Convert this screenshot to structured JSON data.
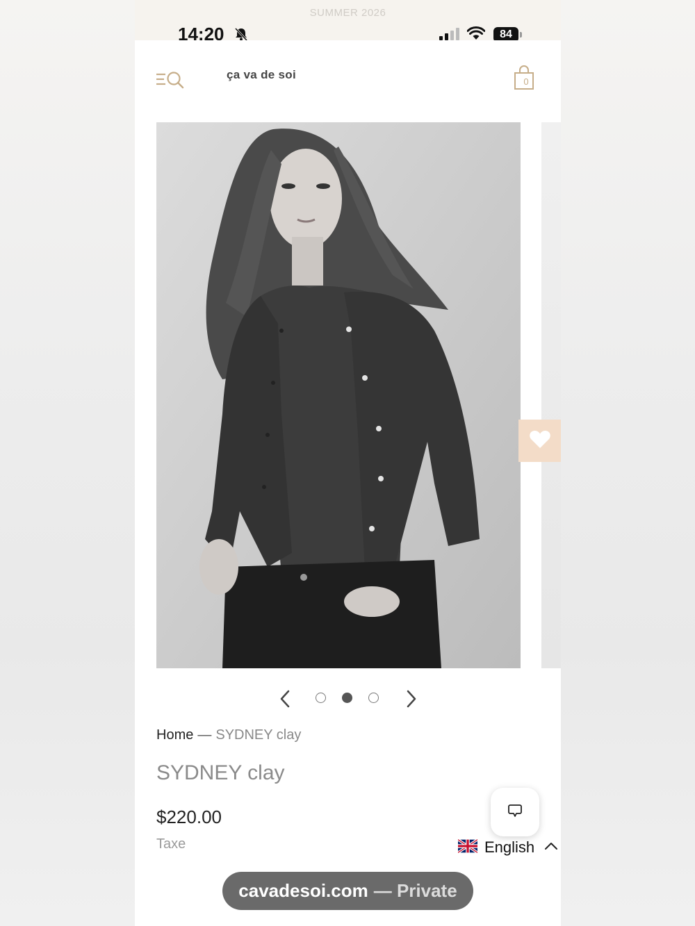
{
  "announcement": "SUMMER 2026",
  "status_bar": {
    "time": "14:20",
    "battery": "84"
  },
  "header": {
    "logo": "ça va de soi",
    "cart_count": "0"
  },
  "carousel": {
    "slide_count": 3,
    "active_slide": 2
  },
  "breadcrumb": {
    "home": "Home",
    "separator": "—",
    "current": "SYDNEY clay"
  },
  "product": {
    "title": "SYDNEY clay",
    "price": "$220.00",
    "tax_note": "Taxe"
  },
  "language": {
    "selected": "English"
  },
  "browser": {
    "domain": "cavadesoi.com",
    "mode": "— Private"
  },
  "colors": {
    "accent": "#c6ad88",
    "wishlist_bg": "#f3dcc8"
  }
}
